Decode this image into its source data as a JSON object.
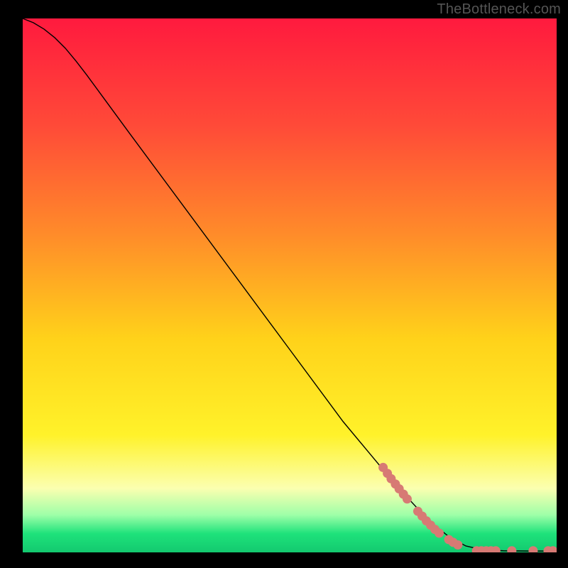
{
  "watermark": "TheBottleneck.com",
  "chart_data": {
    "type": "line",
    "title": "",
    "xlabel": "",
    "ylabel": "",
    "xlim": [
      0,
      100
    ],
    "ylim": [
      0,
      100
    ],
    "background_gradient": {
      "stops": [
        {
          "offset": 0.0,
          "color": "#ff1a3e"
        },
        {
          "offset": 0.2,
          "color": "#ff4a38"
        },
        {
          "offset": 0.4,
          "color": "#ff8a2a"
        },
        {
          "offset": 0.6,
          "color": "#ffd21a"
        },
        {
          "offset": 0.78,
          "color": "#fff22a"
        },
        {
          "offset": 0.88,
          "color": "#fbffb0"
        },
        {
          "offset": 0.93,
          "color": "#9effa8"
        },
        {
          "offset": 0.965,
          "color": "#1ee27b"
        },
        {
          "offset": 1.0,
          "color": "#13c96f"
        }
      ]
    },
    "series": [
      {
        "name": "bottleneck-curve",
        "type": "line",
        "color": "#000000",
        "width": 1.4,
        "points": [
          {
            "x": 0.0,
            "y": 100.0
          },
          {
            "x": 2.0,
            "y": 99.2
          },
          {
            "x": 4.0,
            "y": 98.0
          },
          {
            "x": 6.0,
            "y": 96.4
          },
          {
            "x": 8.0,
            "y": 94.4
          },
          {
            "x": 10.0,
            "y": 92.0
          },
          {
            "x": 12.0,
            "y": 89.4
          },
          {
            "x": 14.5,
            "y": 86.0
          },
          {
            "x": 20.0,
            "y": 78.5
          },
          {
            "x": 30.0,
            "y": 65.0
          },
          {
            "x": 40.0,
            "y": 51.5
          },
          {
            "x": 50.0,
            "y": 38.0
          },
          {
            "x": 60.0,
            "y": 24.5
          },
          {
            "x": 70.0,
            "y": 12.5
          },
          {
            "x": 76.0,
            "y": 6.0
          },
          {
            "x": 80.0,
            "y": 2.8
          },
          {
            "x": 83.0,
            "y": 1.2
          },
          {
            "x": 86.0,
            "y": 0.5
          },
          {
            "x": 90.0,
            "y": 0.3
          },
          {
            "x": 95.0,
            "y": 0.25
          },
          {
            "x": 100.0,
            "y": 0.25
          }
        ]
      },
      {
        "name": "markers",
        "type": "scatter",
        "color": "#d77a74",
        "radius": 6.5,
        "points": [
          {
            "x": 67.5,
            "y": 15.9
          },
          {
            "x": 68.3,
            "y": 14.8
          },
          {
            "x": 69.0,
            "y": 13.8
          },
          {
            "x": 69.8,
            "y": 12.8
          },
          {
            "x": 70.5,
            "y": 11.9
          },
          {
            "x": 71.3,
            "y": 10.9
          },
          {
            "x": 72.0,
            "y": 10.0
          },
          {
            "x": 74.0,
            "y": 7.7
          },
          {
            "x": 74.8,
            "y": 6.8
          },
          {
            "x": 75.6,
            "y": 5.9
          },
          {
            "x": 76.4,
            "y": 5.1
          },
          {
            "x": 77.2,
            "y": 4.3
          },
          {
            "x": 78.0,
            "y": 3.6
          },
          {
            "x": 79.8,
            "y": 2.4
          },
          {
            "x": 80.6,
            "y": 1.9
          },
          {
            "x": 81.5,
            "y": 1.4
          },
          {
            "x": 85.0,
            "y": 0.3
          },
          {
            "x": 85.9,
            "y": 0.3
          },
          {
            "x": 86.8,
            "y": 0.3
          },
          {
            "x": 87.7,
            "y": 0.3
          },
          {
            "x": 88.6,
            "y": 0.3
          },
          {
            "x": 91.6,
            "y": 0.3
          },
          {
            "x": 95.6,
            "y": 0.3
          },
          {
            "x": 98.4,
            "y": 0.3
          },
          {
            "x": 99.3,
            "y": 0.3
          }
        ]
      }
    ]
  }
}
